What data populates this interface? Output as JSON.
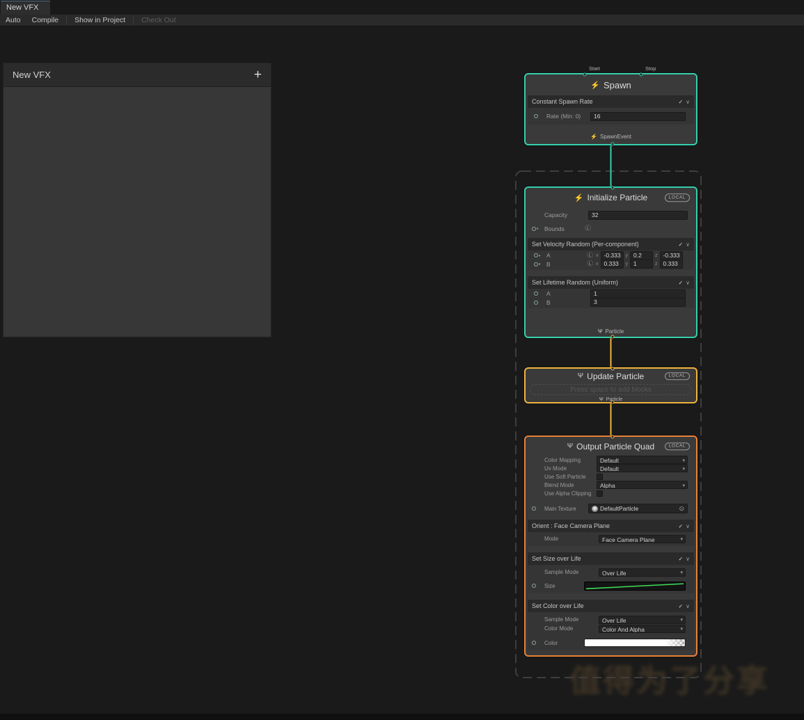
{
  "window": {
    "tab_title": "New VFX"
  },
  "toolbar": {
    "auto": "Auto",
    "compile": "Compile",
    "show_in_project": "Show in Project",
    "check_out": "Check Out"
  },
  "blackboard": {
    "title": "New VFX"
  },
  "icons": {
    "lightning": "⚡",
    "particle": "Ψ",
    "check": "✓",
    "chevron_down": "∨",
    "dropdown_arrow": "▾",
    "add": "+",
    "local_space": "Ⓛ",
    "port_expand": "▸",
    "object_picker": "⊙"
  },
  "colors": {
    "spawn_context_border": "#35d0ad",
    "update_context_border": "#f0b43f",
    "output_context_border": "#ea8338",
    "spawn_flow_link": "#35d0ad",
    "particle_flow_link": "#f0b43f",
    "size_curve": "#41dd57"
  },
  "spawn": {
    "start_label": "Start",
    "stop_label": "Stop",
    "title": "Spawn",
    "block_title": "Constant Spawn Rate",
    "rate_label": "Rate (Min: 0)",
    "rate_value": "16",
    "flow_out": "SpawnEvent"
  },
  "initialize": {
    "title": "Initialize Particle",
    "badge": "LOCAL",
    "capacity_label": "Capacity",
    "capacity_value": "32",
    "bounds_label": "Bounds",
    "velocity_block": {
      "title": "Set Velocity Random (Per-component)",
      "a_label": "A",
      "b_label": "B",
      "x_label": "x",
      "y_label": "y",
      "z_label": "z",
      "a_x": "-0.333",
      "a_y": "0.2",
      "a_z": "-0.333",
      "b_x": "0.333",
      "b_y": "1",
      "b_z": "0.333"
    },
    "lifetime_block": {
      "title": "Set Lifetime Random (Uniform)",
      "a_label": "A",
      "a_value": "1",
      "b_label": "B",
      "b_value": "3"
    },
    "flow_out": "Particle"
  },
  "update": {
    "title": "Update Particle",
    "badge": "LOCAL",
    "placeholder": "Press space to add blocks",
    "flow_out": "Particle"
  },
  "output": {
    "title": "Output Particle Quad",
    "badge": "LOCAL",
    "settings": [
      {
        "label": "Color Mapping",
        "value": "Default"
      },
      {
        "label": "Uv Mode",
        "value": "Default"
      },
      {
        "label": "Use Soft Particle",
        "value": ""
      },
      {
        "label": "Blend Mode",
        "value": "Alpha"
      },
      {
        "label": "Use Alpha Clipping",
        "value": ""
      }
    ],
    "main_texture_label": "Main Texture",
    "main_texture_value": "DefaultParticle",
    "orient_block": {
      "title": "Orient : Face Camera Plane",
      "mode_label": "Mode",
      "mode_value": "Face Camera Plane"
    },
    "size_block": {
      "title": "Set Size over Life",
      "sample_mode_label": "Sample Mode",
      "sample_mode_value": "Over Life",
      "size_label": "Size"
    },
    "color_block": {
      "title": "Set Color over Life",
      "sample_mode_label": "Sample Mode",
      "sample_mode_value": "Over Life",
      "color_mode_label": "Color Mode",
      "color_mode_value": "Color And Alpha",
      "color_label": "Color"
    }
  },
  "watermark": "值得为了分享"
}
